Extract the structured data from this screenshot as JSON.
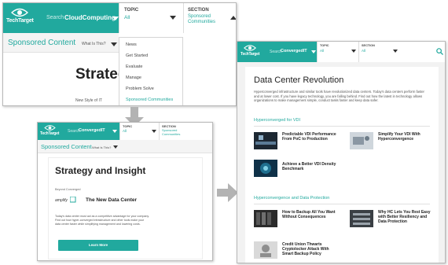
{
  "colors": {
    "brand_teal": "#21a99e",
    "arrow_gray": "#b3b3b3"
  },
  "icons": [
    "techtarget-eye-icon",
    "chevron-down-icon",
    "chevron-up-icon",
    "search-icon",
    "gray-flow-arrow"
  ],
  "brand": {
    "logo_text": "TechTarget"
  },
  "shot1": {
    "search_label": "Search",
    "search_value": "CloudComputing",
    "topic_label": "TOPIC",
    "topic_value": "All",
    "section_label": "SECTION",
    "section_value_line1": "Sponsored",
    "section_value_line2": "Communities",
    "sponsored_title": "Sponsored Content",
    "what_is_this": "What Is This?",
    "hero_fragment": "Strateg",
    "news_fragment": "New Style of IT",
    "dropdown_items": [
      "News",
      "Get Started",
      "Evaluate",
      "Manage",
      "Problem Solve",
      "Sponsored Communities"
    ]
  },
  "shot2": {
    "search_label": "Search",
    "search_value": "ConvergedIT",
    "topic_label": "TOPIC",
    "topic_value": "All",
    "section_label": "SECTION",
    "section_value_line1": "Sponsored",
    "section_value_line2": "Communities",
    "sponsored_title": "Sponsored Content",
    "what_is_this": "What Is This?",
    "hero_title": "Strategy and Insight",
    "byline": "Beyond Converged",
    "sponsor_logo": "amplify",
    "card_title": "The New Data Center",
    "body_text": "Today's data center must act as a competitive advantage for your company. Find out how hyper-converged infrastructure and other tools make your data center faster while simplifying management and lowering costs.",
    "cta": "Learn More"
  },
  "shot3": {
    "search_label": "Search",
    "search_value": "ConvergedIT",
    "topic_label": "TOPIC",
    "topic_value": "All",
    "section_label": "SECTION",
    "section_value": "All",
    "headline": "Data Center Revolution",
    "intro": "Hyperconverged infrastructure and similar tools have revolutionized data centers. Today's data centers perform faster and at lower cost. If you have legacy technology, you are falling behind. Find out how the latest in technology allows organizations to make management simple, conduct tasks faster and keep data safer.",
    "section1_title": "Hyperconverged for VDI",
    "articles1": [
      "Predictable VDI Performance From PoC to Production",
      "Simplify Your VDI With Hyperconvergence",
      "Achieve a Better VDI Density Benchmark"
    ],
    "section2_title": "Hyperconvergence and Data Protection",
    "articles2": [
      "How to Backup All You Want Without Consequences",
      "Why HC Lets You Rest Easy with Better Resiliency and Data Protection",
      "Credit Union Thwarts Cryptolocker Attack With Smart Backup Policy"
    ]
  }
}
